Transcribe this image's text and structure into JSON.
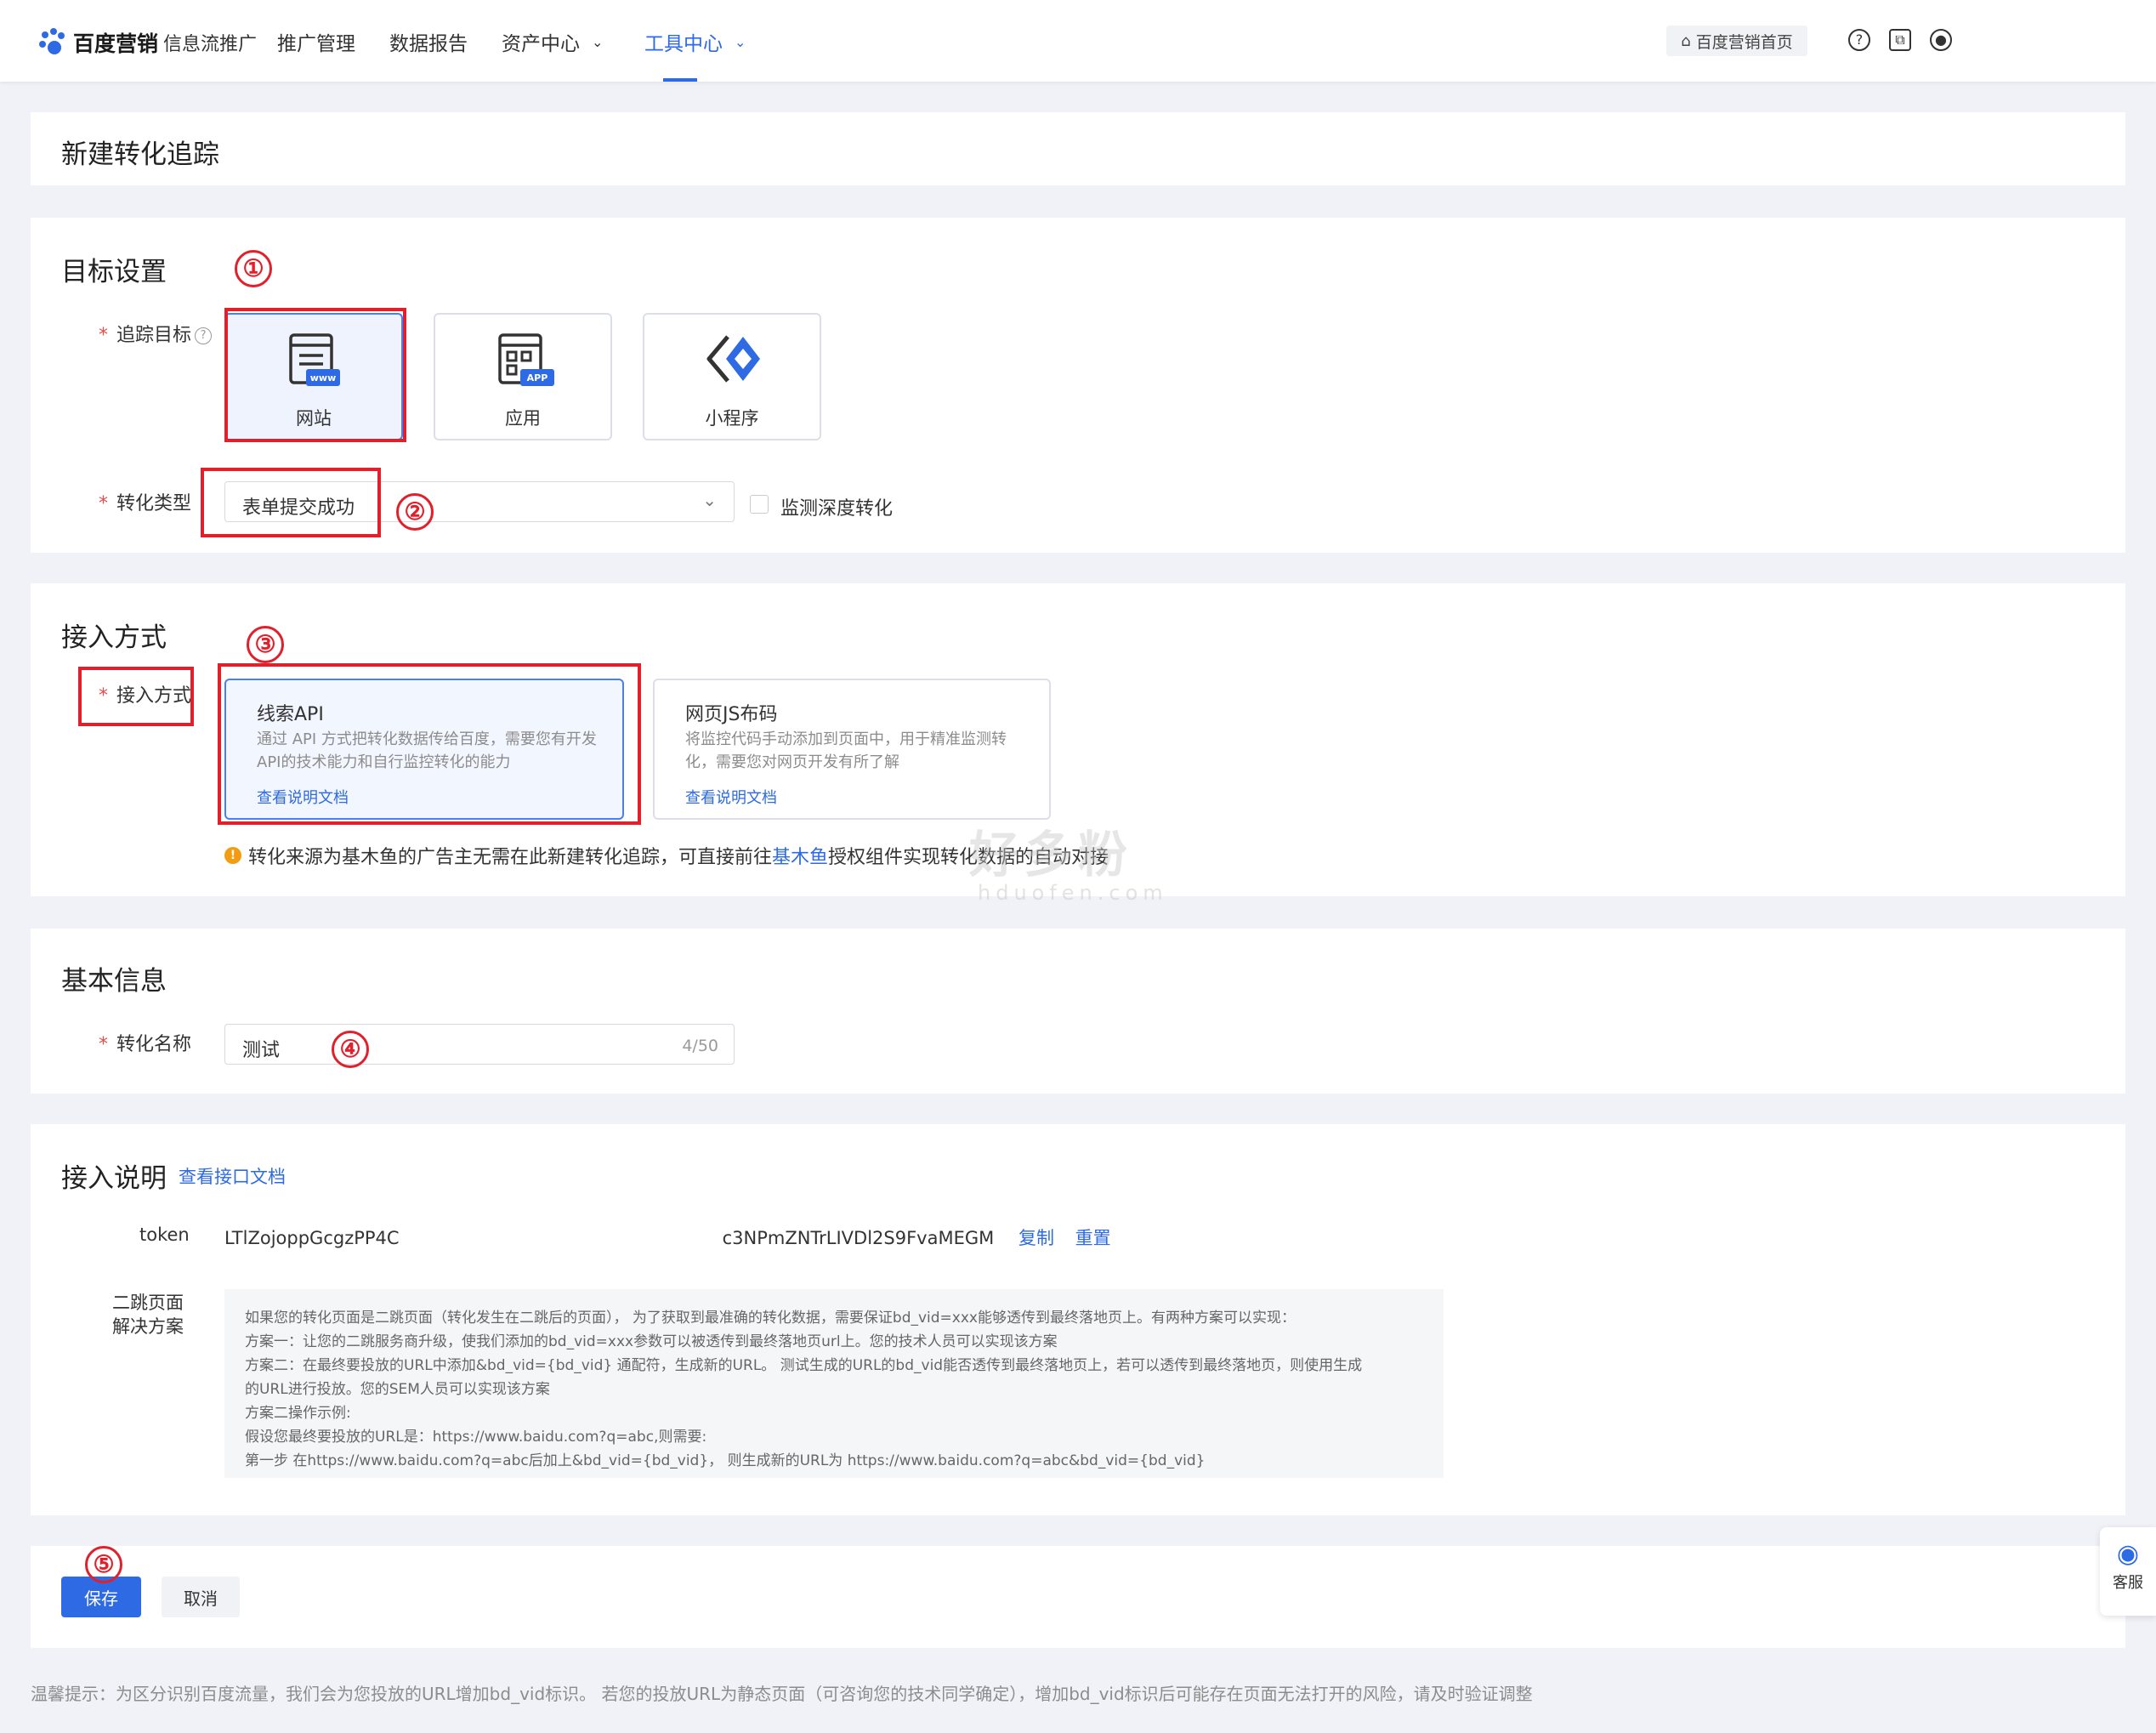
{
  "header": {
    "brand": "百度营销",
    "product": "信息流推广",
    "nav": [
      {
        "label": "推广管理"
      },
      {
        "label": "数据报告"
      },
      {
        "label": "资产中心"
      },
      {
        "label": "工具中心"
      }
    ],
    "home_button": "百度营销首页",
    "icons": [
      "help-icon",
      "copy-icon",
      "user-icon"
    ]
  },
  "page_title": "新建转化追踪",
  "target_section": {
    "title": "目标设置",
    "track_label": "追踪目标",
    "targets": [
      {
        "label": "网站",
        "selected": true,
        "badge": "www"
      },
      {
        "label": "应用",
        "selected": false,
        "badge": "APP"
      },
      {
        "label": "小程序",
        "selected": false
      }
    ],
    "type_label": "转化类型",
    "type_value": "表单提交成功",
    "deep_checkbox_label": "监测深度转化"
  },
  "access_section": {
    "title": "接入方式",
    "label": "接入方式",
    "methods": [
      {
        "title": "线索API",
        "desc": "通过 API 方式把转化数据传给百度，需要您有开发API的技术能力和自行监控转化的能力",
        "link": "查看说明文档",
        "selected": true
      },
      {
        "title": "网页JS布码",
        "desc": "将监控代码手动添加到页面中，用于精准监测转化，需要您对网页开发有所了解",
        "link": "查看说明文档",
        "selected": false
      }
    ],
    "warning_prefix": "转化来源为基木鱼的广告主无需在此新建转化追踪，可直接前往",
    "warning_link": "基木鱼",
    "warning_suffix": "授权组件实现转化数据的自动对接"
  },
  "basic_section": {
    "title": "基本信息",
    "name_label": "转化名称",
    "name_value": "测试",
    "name_count": "4/50"
  },
  "guide_section": {
    "title": "接入说明",
    "doc_link": "查看接口文档",
    "token_label": "token",
    "token_prefix": "LTlZojoppGcgzPP4C",
    "token_suffix": "c3NPmZNTrLIVDl2S9FvaMEGM",
    "copy_link": "复制",
    "reset_link": "重置",
    "solution_label_1": "二跳页面",
    "solution_label_2": "解决方案",
    "solution_lines": [
      "如果您的转化页面是二跳页面（转化发生在二跳后的页面）， 为了获取到最准确的转化数据，需要保证bd_vid=xxx能够透传到最终落地页上。有两种方案可以实现：",
      "方案一：让您的二跳服务商升级，使我们添加的bd_vid=xxx参数可以被透传到最终落地页url上。您的技术人员可以实现该方案",
      "方案二：在最终要投放的URL中添加&bd_vid={bd_vid} 通配符，生成新的URL。 测试生成的URL的bd_vid能否透传到最终落地页上，若可以透传到最终落地页，则使用生成",
      "的URL进行投放。您的SEM人员可以实现该方案",
      "方案二操作示例:",
      "假设您最终要投放的URL是：https://www.baidu.com?q=abc,则需要:",
      "第一步 在https://www.baidu.com?q=abc后加上&bd_vid={bd_vid}， 则生成新的URL为 https://www.baidu.com?q=abc&bd_vid={bd_vid}"
    ]
  },
  "actions": {
    "save": "保存",
    "cancel": "取消"
  },
  "footer_tip": "温馨提示：为区分识别百度流量，我们会为您投放的URL增加bd_vid标识。 若您的投放URL为静态页面（可咨询您的技术同学确定），增加bd_vid标识后可能存在页面无法打开的风险，请及时验证调整",
  "service_label": "客服",
  "annotations": [
    "①",
    "②",
    "③",
    "④",
    "⑤"
  ],
  "watermark": {
    "main": "好多粉",
    "sub": "hduofen.com"
  },
  "colors": {
    "accent": "#2d6ae3",
    "annotation_red": "#e2202b",
    "warning": "#f39c12"
  }
}
